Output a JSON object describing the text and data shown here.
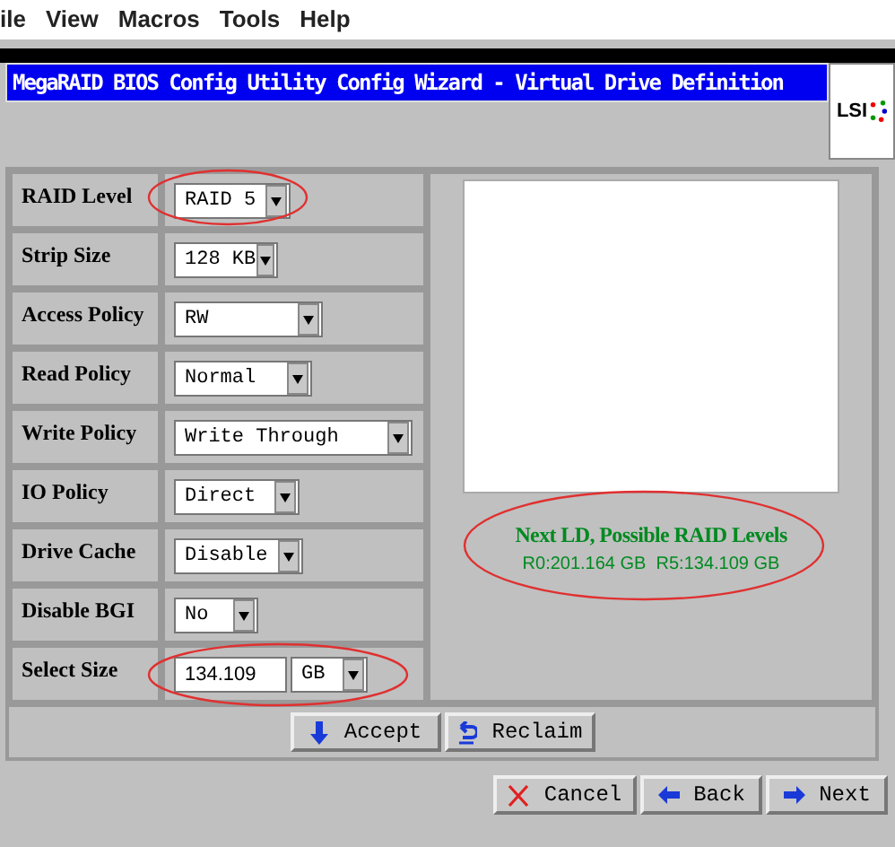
{
  "menu": [
    "ile",
    "View",
    "Macros",
    "Tools",
    "Help"
  ],
  "window": {
    "title": "MegaRAID BIOS Config Utility  Config Wizard - Virtual Drive Definition",
    "logo": "LSI"
  },
  "fields": [
    {
      "kind": "dropdown",
      "label": "RAID Level",
      "value": "RAID 5"
    },
    {
      "kind": "dropdown",
      "label": "Strip Size",
      "value": "128 KB"
    },
    {
      "kind": "dropdown",
      "label": "Access Policy",
      "value": "RW"
    },
    {
      "kind": "dropdown",
      "label": "Read Policy",
      "value": "Normal"
    },
    {
      "kind": "dropdown",
      "label": "Write Policy",
      "value": "Write Through"
    },
    {
      "kind": "dropdown",
      "label": "IO Policy",
      "value": "Direct"
    },
    {
      "kind": "dropdown",
      "label": "Drive Cache",
      "value": "Disable"
    },
    {
      "kind": "dropdown",
      "label": "Disable BGI",
      "value": "No"
    },
    {
      "kind": "size",
      "label": "Select Size",
      "value": "134.109",
      "unit": "GB"
    }
  ],
  "info": {
    "heading": "Next LD, Possible RAID Levels",
    "detail": "R0:201.164 GB  R5:134.109 GB"
  },
  "actions": [
    "Accept",
    "Reclaim"
  ],
  "nav": [
    "Cancel",
    "Back",
    "Next"
  ]
}
